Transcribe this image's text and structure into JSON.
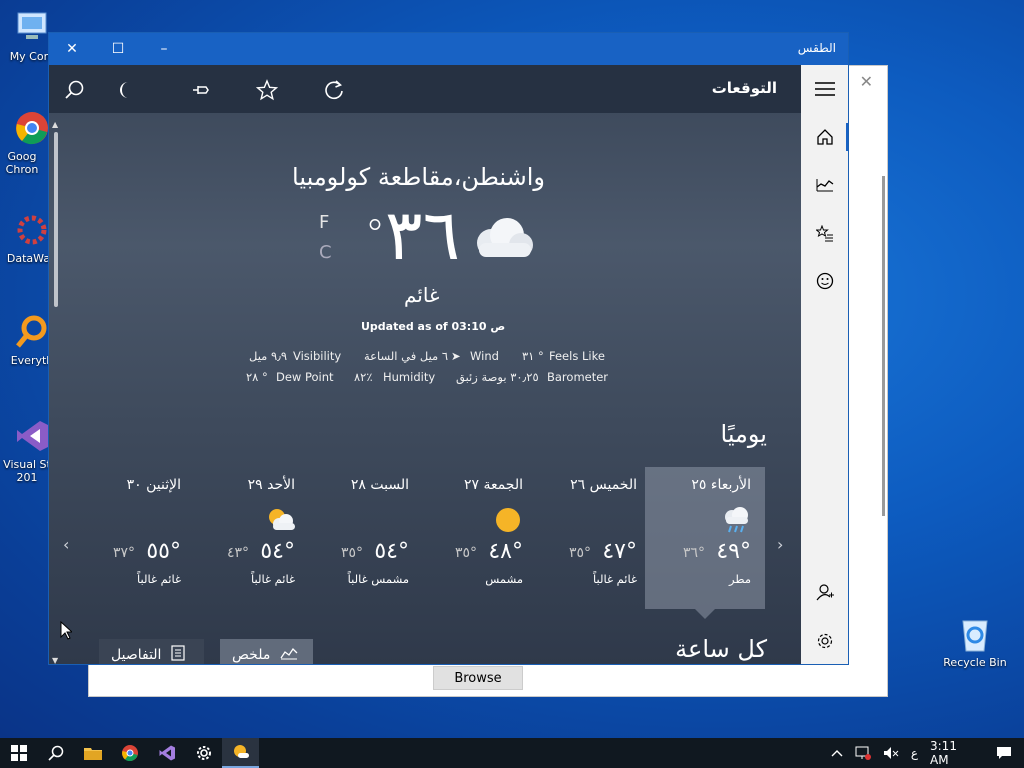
{
  "desktop": {
    "icons": [
      {
        "label": "My Com"
      },
      {
        "label": "Goog Chron"
      },
      {
        "label": "DataWag"
      },
      {
        "label": "Everyth"
      },
      {
        "label": "Visual St 201"
      },
      {
        "label": "Recycle Bin"
      }
    ],
    "background_dialog": {
      "browse_label": "Browse"
    }
  },
  "window": {
    "title": "الطقس",
    "toolbar_title": "التوقعات",
    "location": "واشنطن،مقاطعة كولومبيا",
    "temperature": "٣٦",
    "degree": "°",
    "unit_f": "F",
    "unit_c": "C",
    "condition": "غائم",
    "updated": "Updated as of 03:10 ص",
    "details": {
      "feels_like_label": "Feels Like",
      "feels_like_value": "٣١ °",
      "wind_label": "Wind",
      "wind_value": "٦ ميل في الساعة",
      "visibility_label": "Visibility",
      "visibility_value": "٩٫٩ ميل",
      "barometer_label": "Barometer",
      "barometer_value": "٣٠٫٢٥ بوصة زئبق",
      "humidity_label": "Humidity",
      "humidity_value": "٨٢٪",
      "dew_point_label": "Dew Point",
      "dew_point_value": "٢٨ °"
    },
    "daily_heading": "يوميًا",
    "days": [
      {
        "name": "الأربعاء ٢٥",
        "icon": "rain-cloud-icon",
        "high": "٤٩°",
        "low": "٣٦°",
        "desc": "مطر"
      },
      {
        "name": "الخميس ٢٦",
        "icon": "none",
        "high": "٤٧°",
        "low": "٣٥°",
        "desc": "غائم غالباً"
      },
      {
        "name": "الجمعة ٢٧",
        "icon": "sun-icon",
        "high": "٤٨°",
        "low": "٣٥°",
        "desc": "مشمس"
      },
      {
        "name": "السبت ٢٨",
        "icon": "none",
        "high": "٥٤°",
        "low": "٣٥°",
        "desc": "مشمس غالباً"
      },
      {
        "name": "الأحد ٢٩",
        "icon": "partly-cloudy-icon",
        "high": "٥٤°",
        "low": "٤٣°",
        "desc": "غائم غالباً"
      },
      {
        "name": "الإثنين ٣٠",
        "icon": "none",
        "high": "٥٥°",
        "low": "٣٧°",
        "desc": "غائم غالباً"
      }
    ],
    "hourly_heading": "كل ساعة",
    "summary_label": "ملخص",
    "details_label": "التفاصيل"
  },
  "taskbar": {
    "lang": "ع",
    "time": "3:11 AM"
  },
  "colors": {
    "accent": "#1862c4",
    "window_bg": "#3a4658",
    "rail_bg": "#f2f2f2",
    "taskbar_bg": "#101820"
  }
}
